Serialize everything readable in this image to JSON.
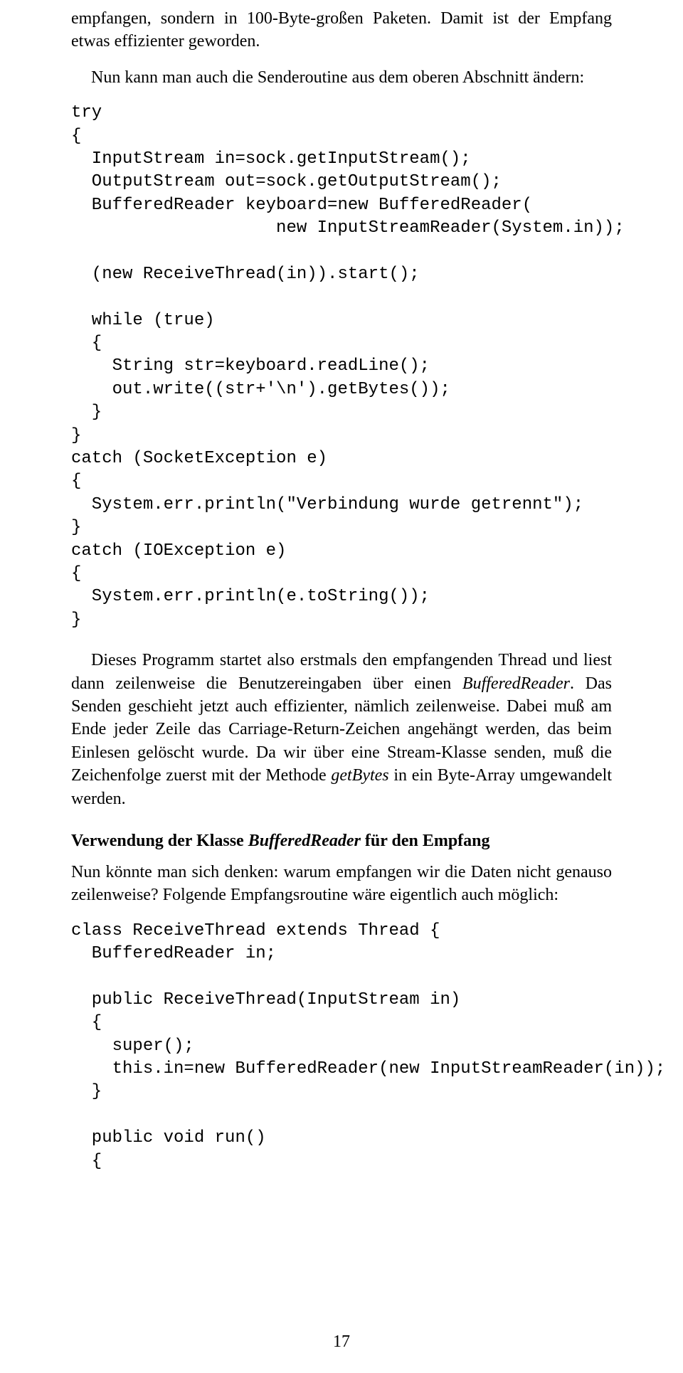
{
  "para1": "empfangen, sondern in 100-Byte-großen Paketen. Damit ist der Empfang etwas effizienter geworden.",
  "para2": "Nun kann man auch die Senderoutine aus dem oberen Abschnitt ändern:",
  "code1": "try\n{\n  InputStream in=sock.getInputStream();\n  OutputStream out=sock.getOutputStream();\n  BufferedReader keyboard=new BufferedReader(\n                    new InputStreamReader(System.in));\n\n  (new ReceiveThread(in)).start();\n\n  while (true)\n  {\n    String str=keyboard.readLine();\n    out.write((str+'\\n').getBytes());\n  }\n}\ncatch (SocketException e)\n{\n  System.err.println(\"Verbindung wurde getrennt\");\n}\ncatch (IOException e)\n{\n  System.err.println(e.toString());\n}",
  "para3a": "Dieses Programm startet also erstmals den empfangenden Thread und liest dann zeilenweise die Benutzereingaben über einen ",
  "para3_em1": "BufferedReader",
  "para3b": ". Das Senden geschieht jetzt auch effizienter, nämlich zeilenweise. Dabei muß am Ende jeder Zeile das Carriage-Return-Zeichen angehängt werden, das beim Einlesen gelöscht wurde. Da wir über eine Stream-Klasse senden, muß die Zeichenfolge zuerst mit der Methode ",
  "para3_em2": "getBytes",
  "para3c": " in ein Byte-Array umgewandelt werden.",
  "heading_a": "Verwendung der Klasse ",
  "heading_em": "BufferedReader",
  "heading_b": " für den Empfang",
  "para4": "Nun könnte man sich denken: warum empfangen wir die Daten nicht genauso zeilenweise? Folgende Empfangsroutine wäre eigentlich auch möglich:",
  "code2": "class ReceiveThread extends Thread {\n  BufferedReader in;\n\n  public ReceiveThread(InputStream in)\n  {\n    super();\n    this.in=new BufferedReader(new InputStreamReader(in));\n  }\n\n  public void run()\n  {",
  "pagenum": "17"
}
